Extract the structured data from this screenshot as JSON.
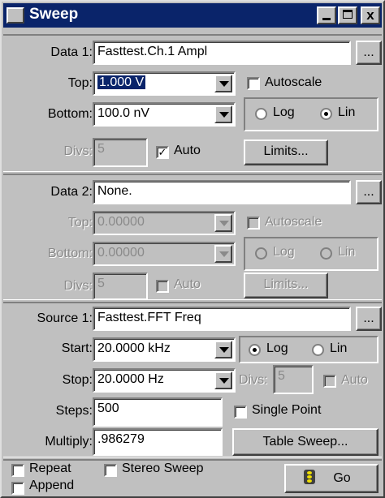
{
  "window": {
    "title": "Sweep",
    "minimize_label": "_",
    "close_label": "x"
  },
  "data1": {
    "label": "Data 1:",
    "value": "Fasttest.Ch.1 Ampl",
    "browse_label": "...",
    "top_label": "Top:",
    "top_value": "1.000  V",
    "autoscale_label": "Autoscale",
    "autoscale_checked": false,
    "bottom_label": "Bottom:",
    "bottom_value": "100.0  nV",
    "log_label": "Log",
    "lin_label": "Lin",
    "scale_selected": "Lin",
    "divs_label": "Divs:",
    "divs_value": "5",
    "auto_label": "Auto",
    "auto_checked": true,
    "auto_check_glyph": "✓",
    "limits_label": "Limits..."
  },
  "data2": {
    "label": "Data 2:",
    "value": "None.",
    "browse_label": "...",
    "top_label": "Top:",
    "top_value": "0.00000",
    "autoscale_label": "Autoscale",
    "bottom_label": "Bottom:",
    "bottom_value": "0.00000",
    "log_label": "Log",
    "lin_label": "Lin",
    "divs_label": "Divs:",
    "divs_value": "5",
    "auto_label": "Auto",
    "limits_label": "Limits..."
  },
  "source1": {
    "label": "Source 1:",
    "value": "Fasttest.FFT Freq",
    "browse_label": "...",
    "start_label": "Start:",
    "start_value": "20.0000 kHz",
    "log_label": "Log",
    "lin_label": "Lin",
    "scale_selected": "Log",
    "stop_label": "Stop:",
    "stop_value": "20.0000  Hz",
    "divs_label": "Divs:",
    "divs_value": "5",
    "auto_label": "Auto",
    "steps_label": "Steps:",
    "steps_value": "500",
    "single_point_label": "Single Point",
    "single_point_checked": false,
    "multiply_label": "Multiply:",
    "multiply_value": ".986279",
    "table_sweep_label": "Table Sweep..."
  },
  "options": {
    "repeat_label": "Repeat",
    "stereo_label": "Stereo Sweep",
    "append_label": "Append",
    "go_label": "Go"
  },
  "colors": {
    "titlebar": "#0a246a",
    "face": "#c0c0c0",
    "disabled_text": "#8a8a8a"
  }
}
